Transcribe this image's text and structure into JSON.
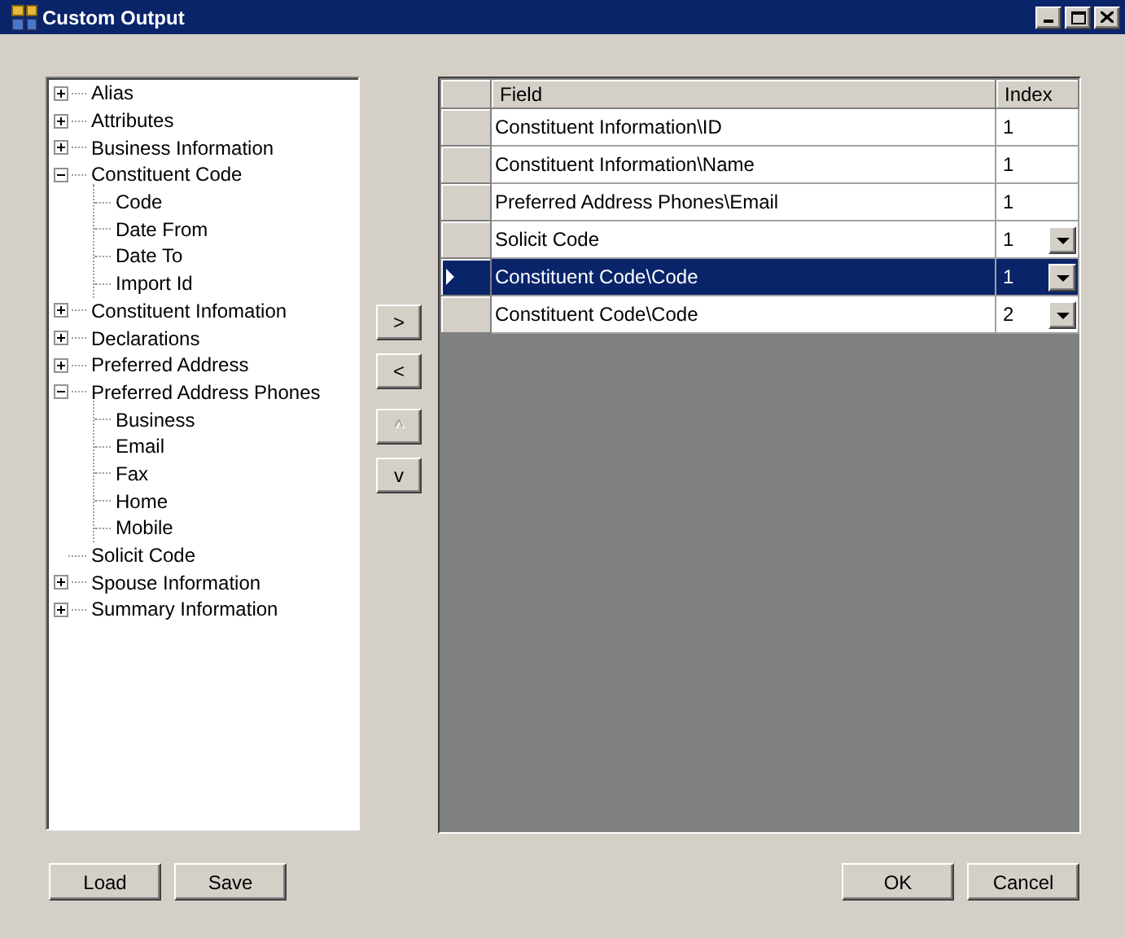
{
  "window": {
    "title": "Custom Output"
  },
  "tree": [
    {
      "label": "Alias",
      "expanded": false
    },
    {
      "label": "Attributes",
      "expanded": false
    },
    {
      "label": "Business Information",
      "expanded": false
    },
    {
      "label": "Constituent Code",
      "expanded": true,
      "children": [
        {
          "label": "Code"
        },
        {
          "label": "Date From"
        },
        {
          "label": "Date To"
        },
        {
          "label": "Import Id"
        }
      ]
    },
    {
      "label": "Constituent Infomation",
      "expanded": false
    },
    {
      "label": "Declarations",
      "expanded": false
    },
    {
      "label": "Preferred Address",
      "expanded": false
    },
    {
      "label": "Preferred Address Phones",
      "expanded": true,
      "children": [
        {
          "label": "Business"
        },
        {
          "label": "Email"
        },
        {
          "label": "Fax"
        },
        {
          "label": "Home"
        },
        {
          "label": "Mobile"
        }
      ]
    },
    {
      "label": "Solicit Code"
    },
    {
      "label": "Spouse Information",
      "expanded": false
    },
    {
      "label": "Summary Information",
      "expanded": false
    }
  ],
  "move_buttons": [
    {
      "label": ">",
      "disabled": false
    },
    {
      "label": "<",
      "disabled": false
    },
    {
      "label": "^",
      "disabled": true
    },
    {
      "label": "v",
      "disabled": false
    }
  ],
  "grid": {
    "columns": [
      "Field",
      "Index"
    ],
    "rows": [
      {
        "field": "Constituent Information\\ID",
        "index": "1",
        "selected": false,
        "dropdown": false
      },
      {
        "field": "Constituent Information\\Name",
        "index": "1",
        "selected": false,
        "dropdown": false
      },
      {
        "field": "Preferred Address Phones\\Email",
        "index": "1",
        "selected": false,
        "dropdown": false
      },
      {
        "field": "Solicit Code",
        "index": "1",
        "selected": false,
        "dropdown": true
      },
      {
        "field": "Constituent Code\\Code",
        "index": "1",
        "selected": true,
        "dropdown": true
      },
      {
        "field": "Constituent Code\\Code",
        "index": "2",
        "selected": false,
        "dropdown": true
      }
    ]
  },
  "left_buttons": [
    "Load",
    "Save"
  ],
  "right_buttons": [
    "OK",
    "Cancel"
  ]
}
